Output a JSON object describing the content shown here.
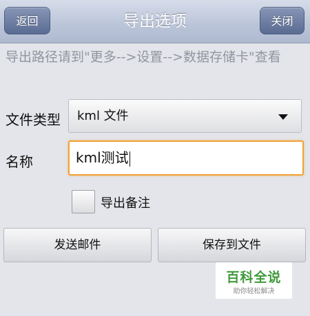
{
  "header": {
    "title": "导出选项",
    "back_label": "返回",
    "close_label": "关闭"
  },
  "hint": "导出路径请到\"更多-->设置-->数据存储卡\"查看",
  "form": {
    "file_type_label": "文件类型",
    "file_type_value": "kml 文件",
    "name_label": "名称",
    "name_value": "kml测试",
    "export_notes_label": "导出备注",
    "export_notes_checked": false
  },
  "actions": {
    "send_email_label": "发送邮件",
    "save_to_file_label": "保存到文件"
  },
  "watermark": {
    "main": "百科全说",
    "sub": "助你轻松解决"
  },
  "colors": {
    "accent_focus": "#f0a134",
    "nav_button": "#6a7aa0",
    "watermark_green": "#3f9a3a"
  }
}
